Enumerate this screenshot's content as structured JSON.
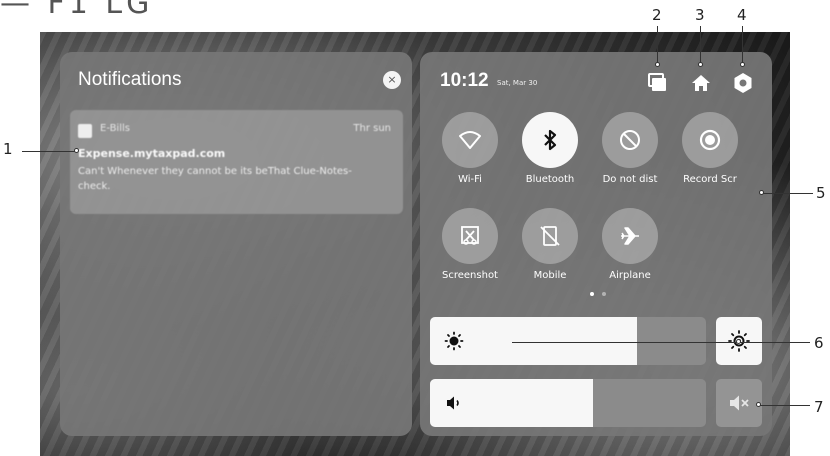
{
  "page": {
    "title_fragment": "— F1 LG"
  },
  "notifications": {
    "title": "Notifications",
    "close_glyph": "×",
    "card": {
      "app": "E-Bills",
      "time": "Thr sun",
      "heading": "Expense.mytaxpad.com",
      "body": "Can't Whenever they cannot be its beThat Clue-Notes-check."
    }
  },
  "quick_settings": {
    "time": "10:12",
    "date": "Sat, Mar 30",
    "top_icons": [
      "recents-icon",
      "home-icon",
      "settings-icon"
    ],
    "tiles": [
      {
        "label": "Wi-Fi",
        "icon": "wifi-icon",
        "active": false
      },
      {
        "label": "Bluetooth",
        "icon": "bluetooth-icon",
        "active": true
      },
      {
        "label": "Do not dist",
        "icon": "do-not-disturb-icon",
        "active": false
      },
      {
        "label": "Record Scr",
        "icon": "record-screen-icon",
        "active": false
      },
      {
        "label": "Screenshot",
        "icon": "screenshot-icon",
        "active": false
      },
      {
        "label": "Mobile",
        "icon": "mobile-data-icon",
        "active": false
      },
      {
        "label": "Airplane",
        "icon": "airplane-icon",
        "active": false
      }
    ],
    "brightness": {
      "level": 0.75,
      "icon": "brightness-icon",
      "auto_icon": "auto-brightness-icon",
      "auto_on": true
    },
    "volume": {
      "level": 0.59,
      "icon": "volume-icon",
      "mute_icon": "mute-icon"
    },
    "page_count": 2,
    "current_page": 1
  },
  "callouts": [
    "1",
    "2",
    "3",
    "4",
    "5",
    "6",
    "7"
  ],
  "colors": {
    "panel": "#767676",
    "active_tile": "#f7f7f7",
    "text": "#ffffff"
  }
}
